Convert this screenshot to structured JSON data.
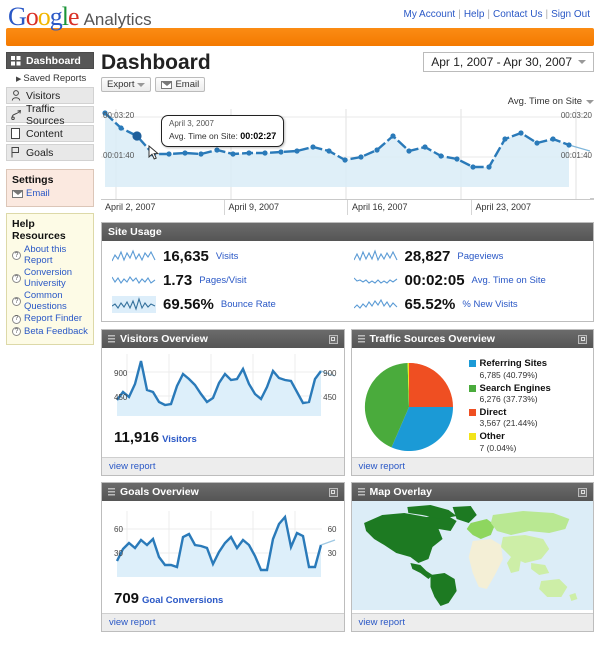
{
  "header": {
    "brand_google": [
      "G",
      "o",
      "o",
      "g",
      "l",
      "e"
    ],
    "brand_suffix": "Analytics",
    "links": [
      "My Account",
      "Help",
      "Contact Us",
      "Sign Out"
    ]
  },
  "sidebar": {
    "nav": [
      {
        "label": "Dashboard",
        "icon": "grid-icon",
        "active": true
      },
      {
        "label": "Visitors",
        "icon": "person-icon",
        "active": false
      },
      {
        "label": "Traffic Sources",
        "icon": "traffic-icon",
        "active": false
      },
      {
        "label": "Content",
        "icon": "page-icon",
        "active": false
      },
      {
        "label": "Goals",
        "icon": "flag-icon",
        "active": false
      }
    ],
    "saved_reports": "Saved Reports",
    "settings": {
      "title": "Settings",
      "items": [
        {
          "label": "Email",
          "icon": "envelope-icon"
        }
      ]
    },
    "help": {
      "title": "Help Resources",
      "items": [
        {
          "label": "About this Report"
        },
        {
          "label": "Conversion University"
        },
        {
          "label": "Common Questions"
        },
        {
          "label": "Report Finder"
        },
        {
          "label": "Beta Feedback"
        }
      ]
    }
  },
  "page": {
    "title": "Dashboard",
    "export_label": "Export",
    "email_label": "Email",
    "date_range": "Apr 1, 2007 - Apr 30, 2007",
    "metric_selector": "Avg. Time on Site"
  },
  "main_chart_tooltip": {
    "date": "April 3, 2007",
    "metric_label": "Avg. Time on Site:",
    "value": "00:02:27"
  },
  "site_usage": {
    "title": "Site Usage",
    "metrics": [
      {
        "value": "16,635",
        "label": "Visits"
      },
      {
        "value": "28,827",
        "label": "Pageviews"
      },
      {
        "value": "1.73",
        "label": "Pages/Visit"
      },
      {
        "value": "00:02:05",
        "label": "Avg. Time on Site"
      },
      {
        "value": "69.56%",
        "label": "Bounce Rate"
      },
      {
        "value": "65.52%",
        "label": "% New Visits"
      }
    ]
  },
  "widgets": {
    "visitors_overview": {
      "title": "Visitors Overview",
      "big_value": "11,916",
      "big_label": "Visitors",
      "view_report": "view report",
      "axis_high": "900",
      "axis_low": "450"
    },
    "traffic_sources": {
      "title": "Traffic Sources Overview",
      "view_report": "view report",
      "legend": [
        {
          "name": "Referring Sites",
          "detail": "6,785 (40.79%)",
          "color": "#1b9ad6"
        },
        {
          "name": "Search Engines",
          "detail": "6,276 (37.73%)",
          "color": "#4aab3c"
        },
        {
          "name": "Direct",
          "detail": "3,567 (21.44%)",
          "color": "#ef4f22"
        },
        {
          "name": "Other",
          "detail": "7 (0.04%)",
          "color": "#f2e41a"
        }
      ]
    },
    "goals_overview": {
      "title": "Goals Overview",
      "big_value": "709",
      "big_label": "Goal Conversions",
      "view_report": "view report",
      "axis_high": "60",
      "axis_low": "30"
    },
    "map_overlay": {
      "title": "Map Overlay",
      "view_report": "view report"
    }
  },
  "chart_data": [
    {
      "type": "line",
      "name": "main-avg-time-on-site",
      "title": "Avg. Time on Site",
      "xlabel": "",
      "ylabel": "Avg. Time on Site",
      "y_ticks": [
        "00:01:40",
        "00:03:20"
      ],
      "y_ticks_right": [
        "00:01:40",
        "00:03:20"
      ],
      "x_ticks": [
        "April 2, 2007",
        "April 9, 2007",
        "April 16, 2007",
        "April 23, 2007"
      ],
      "ylim": [
        60,
        220
      ],
      "x": [
        "Apr 1",
        "Apr 2",
        "Apr 3",
        "Apr 4",
        "Apr 5",
        "Apr 6",
        "Apr 7",
        "Apr 8",
        "Apr 9",
        "Apr 10",
        "Apr 11",
        "Apr 12",
        "Apr 13",
        "Apr 14",
        "Apr 15",
        "Apr 16",
        "Apr 17",
        "Apr 18",
        "Apr 19",
        "Apr 20",
        "Apr 21",
        "Apr 22",
        "Apr 23",
        "Apr 24",
        "Apr 25",
        "Apr 26",
        "Apr 27",
        "Apr 28",
        "Apr 29",
        "Apr 30"
      ],
      "values": [
        215,
        185,
        168,
        133,
        133,
        134,
        133,
        140,
        133,
        134,
        135,
        136,
        139,
        144,
        138,
        120,
        126,
        140,
        168,
        139,
        144,
        128,
        123,
        108,
        108,
        163,
        172,
        155,
        163,
        150
      ],
      "highlight_index": 2,
      "highlight_value": "00:02:27",
      "grid": true,
      "legend": "none"
    },
    {
      "type": "line",
      "name": "visitors-overview-sparkline",
      "title": "Visitors Overview",
      "ylabel": "Visitors",
      "y_ticks": [
        "450",
        "900"
      ],
      "ylim": [
        300,
        1000
      ],
      "values": [
        430,
        520,
        470,
        620,
        940,
        560,
        540,
        420,
        400,
        410,
        600,
        760,
        700,
        620,
        530,
        430,
        470,
        640,
        760,
        690,
        700,
        810,
        640,
        530,
        470,
        620,
        800,
        720,
        700,
        690,
        560,
        420,
        430,
        700,
        810
      ],
      "total": "11,916"
    },
    {
      "type": "pie",
      "name": "traffic-sources-pie",
      "title": "Traffic Sources Overview",
      "labels": [
        "Referring Sites",
        "Search Engines",
        "Direct",
        "Other"
      ],
      "values": [
        6785,
        6276,
        3567,
        7
      ],
      "percents": [
        40.79,
        37.73,
        21.44,
        0.04
      ],
      "colors": [
        "#1b9ad6",
        "#4aab3c",
        "#ef4f22",
        "#f2e41a"
      ],
      "legend": "right"
    },
    {
      "type": "line",
      "name": "goals-overview-sparkline",
      "title": "Goals Overview",
      "ylabel": "Goal Conversions",
      "y_ticks": [
        "30",
        "60"
      ],
      "ylim": [
        12,
        66
      ],
      "values": [
        24,
        33,
        38,
        34,
        40,
        36,
        41,
        27,
        21,
        21,
        20,
        42,
        45,
        37,
        36,
        35,
        22,
        31,
        38,
        42,
        35,
        41,
        37,
        29,
        18,
        18,
        40,
        52,
        59,
        34,
        45,
        43,
        20,
        20,
        35
      ],
      "total": "709"
    },
    {
      "type": "heatmap",
      "name": "map-overlay",
      "title": "Map Overlay",
      "description": "World map choropleth of visitors by region",
      "scale_colors": [
        "#1d7a22",
        "#8ed65f",
        "#c9ed9c",
        "#f2eed3"
      ]
    }
  ]
}
